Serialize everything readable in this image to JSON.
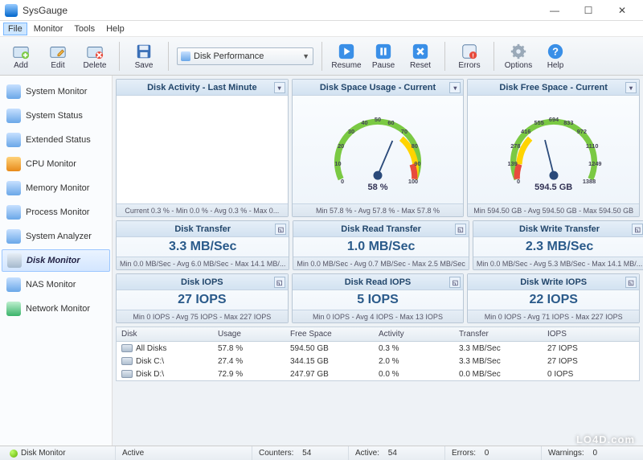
{
  "window": {
    "title": "SysGauge"
  },
  "menu": {
    "items": [
      "File",
      "Monitor",
      "Tools",
      "Help"
    ]
  },
  "toolbar": {
    "add": "Add",
    "edit": "Edit",
    "delete": "Delete",
    "save": "Save",
    "profile_value": "Disk Performance",
    "resume": "Resume",
    "pause": "Pause",
    "reset": "Reset",
    "errors": "Errors",
    "options": "Options",
    "help": "Help"
  },
  "sidebar": {
    "items": [
      {
        "label": "System Monitor"
      },
      {
        "label": "System Status"
      },
      {
        "label": "Extended Status"
      },
      {
        "label": "CPU Monitor"
      },
      {
        "label": "Memory Monitor"
      },
      {
        "label": "Process Monitor"
      },
      {
        "label": "System Analyzer"
      },
      {
        "label": "Disk Monitor",
        "selected": true
      },
      {
        "label": "NAS Monitor"
      },
      {
        "label": "Network Monitor"
      }
    ]
  },
  "panels": {
    "activity": {
      "title": "Disk Activity - Last Minute",
      "footer": "Current 0.3 % - Min 0.0 % - Avg 0.3 % - Max 0..."
    },
    "space_usage": {
      "title": "Disk Space Usage - Current",
      "value": "58 %",
      "footer": "Min 57.8 % - Avg 57.8 % - Max 57.8 %",
      "ticks": [
        "0",
        "10",
        "20",
        "30",
        "40",
        "50",
        "60",
        "70",
        "80",
        "90",
        "100"
      ]
    },
    "free_space": {
      "title": "Disk Free Space - Current",
      "value": "594.5 GB",
      "footer": "Min 594.50 GB - Avg 594.50 GB - Max 594.50 GB",
      "ticks": [
        "0",
        "139",
        "278",
        "416",
        "555",
        "694",
        "833",
        "972",
        "1110",
        "1249",
        "1388"
      ]
    },
    "transfer": {
      "title": "Disk Transfer",
      "value": "3.3 MB/Sec",
      "footer": "Min 0.0 MB/Sec - Avg 6.0 MB/Sec - Max 14.1 MB/..."
    },
    "read_transfer": {
      "title": "Disk Read Transfer",
      "value": "1.0 MB/Sec",
      "footer": "Min 0.0 MB/Sec - Avg 0.7 MB/Sec - Max 2.5 MB/Sec"
    },
    "write_transfer": {
      "title": "Disk Write Transfer",
      "value": "2.3 MB/Sec",
      "footer": "Min 0.0 MB/Sec - Avg 5.3 MB/Sec - Max 14.1 MB/..."
    },
    "iops": {
      "title": "Disk IOPS",
      "value": "27 IOPS",
      "footer": "Min 0 IOPS - Avg 75 IOPS - Max 227 IOPS"
    },
    "read_iops": {
      "title": "Disk Read IOPS",
      "value": "5 IOPS",
      "footer": "Min 0 IOPS - Avg 4 IOPS - Max 13 IOPS"
    },
    "write_iops": {
      "title": "Disk Write IOPS",
      "value": "22 IOPS",
      "footer": "Min 0 IOPS - Avg 71 IOPS - Max 227 IOPS"
    }
  },
  "chart_data": {
    "type": "gauge",
    "gauges": [
      {
        "name": "Disk Space Usage",
        "value": 58,
        "min": 0,
        "max": 100,
        "unit": "%",
        "ticks": [
          0,
          10,
          20,
          30,
          40,
          50,
          60,
          70,
          80,
          90,
          100
        ]
      },
      {
        "name": "Disk Free Space",
        "value": 594.5,
        "min": 0,
        "max": 1388,
        "unit": "GB",
        "ticks": [
          0,
          139,
          278,
          416,
          555,
          694,
          833,
          972,
          1110,
          1249,
          1388
        ]
      }
    ]
  },
  "table": {
    "headers": [
      "Disk",
      "Usage",
      "Free Space",
      "Activity",
      "Transfer",
      "IOPS"
    ],
    "rows": [
      {
        "disk": "All Disks",
        "usage": "57.8 %",
        "free": "594.50 GB",
        "activity": "0.3 %",
        "transfer": "3.3 MB/Sec",
        "iops": "27 IOPS"
      },
      {
        "disk": "Disk C:\\",
        "usage": "27.4 %",
        "free": "344.15 GB",
        "activity": "2.0 %",
        "transfer": "3.3 MB/Sec",
        "iops": "27 IOPS"
      },
      {
        "disk": "Disk D:\\",
        "usage": "72.9 %",
        "free": "247.97 GB",
        "activity": "0.0 %",
        "transfer": "0.0 MB/Sec",
        "iops": "0 IOPS"
      }
    ]
  },
  "status": {
    "mode": "Disk Monitor",
    "state": "Active",
    "counters_label": "Counters:",
    "counters": "54",
    "active_label": "Active:",
    "active": "54",
    "errors_label": "Errors:",
    "errors": "0",
    "warnings_label": "Warnings:",
    "warnings": "0"
  },
  "watermark": "LO4D.com"
}
